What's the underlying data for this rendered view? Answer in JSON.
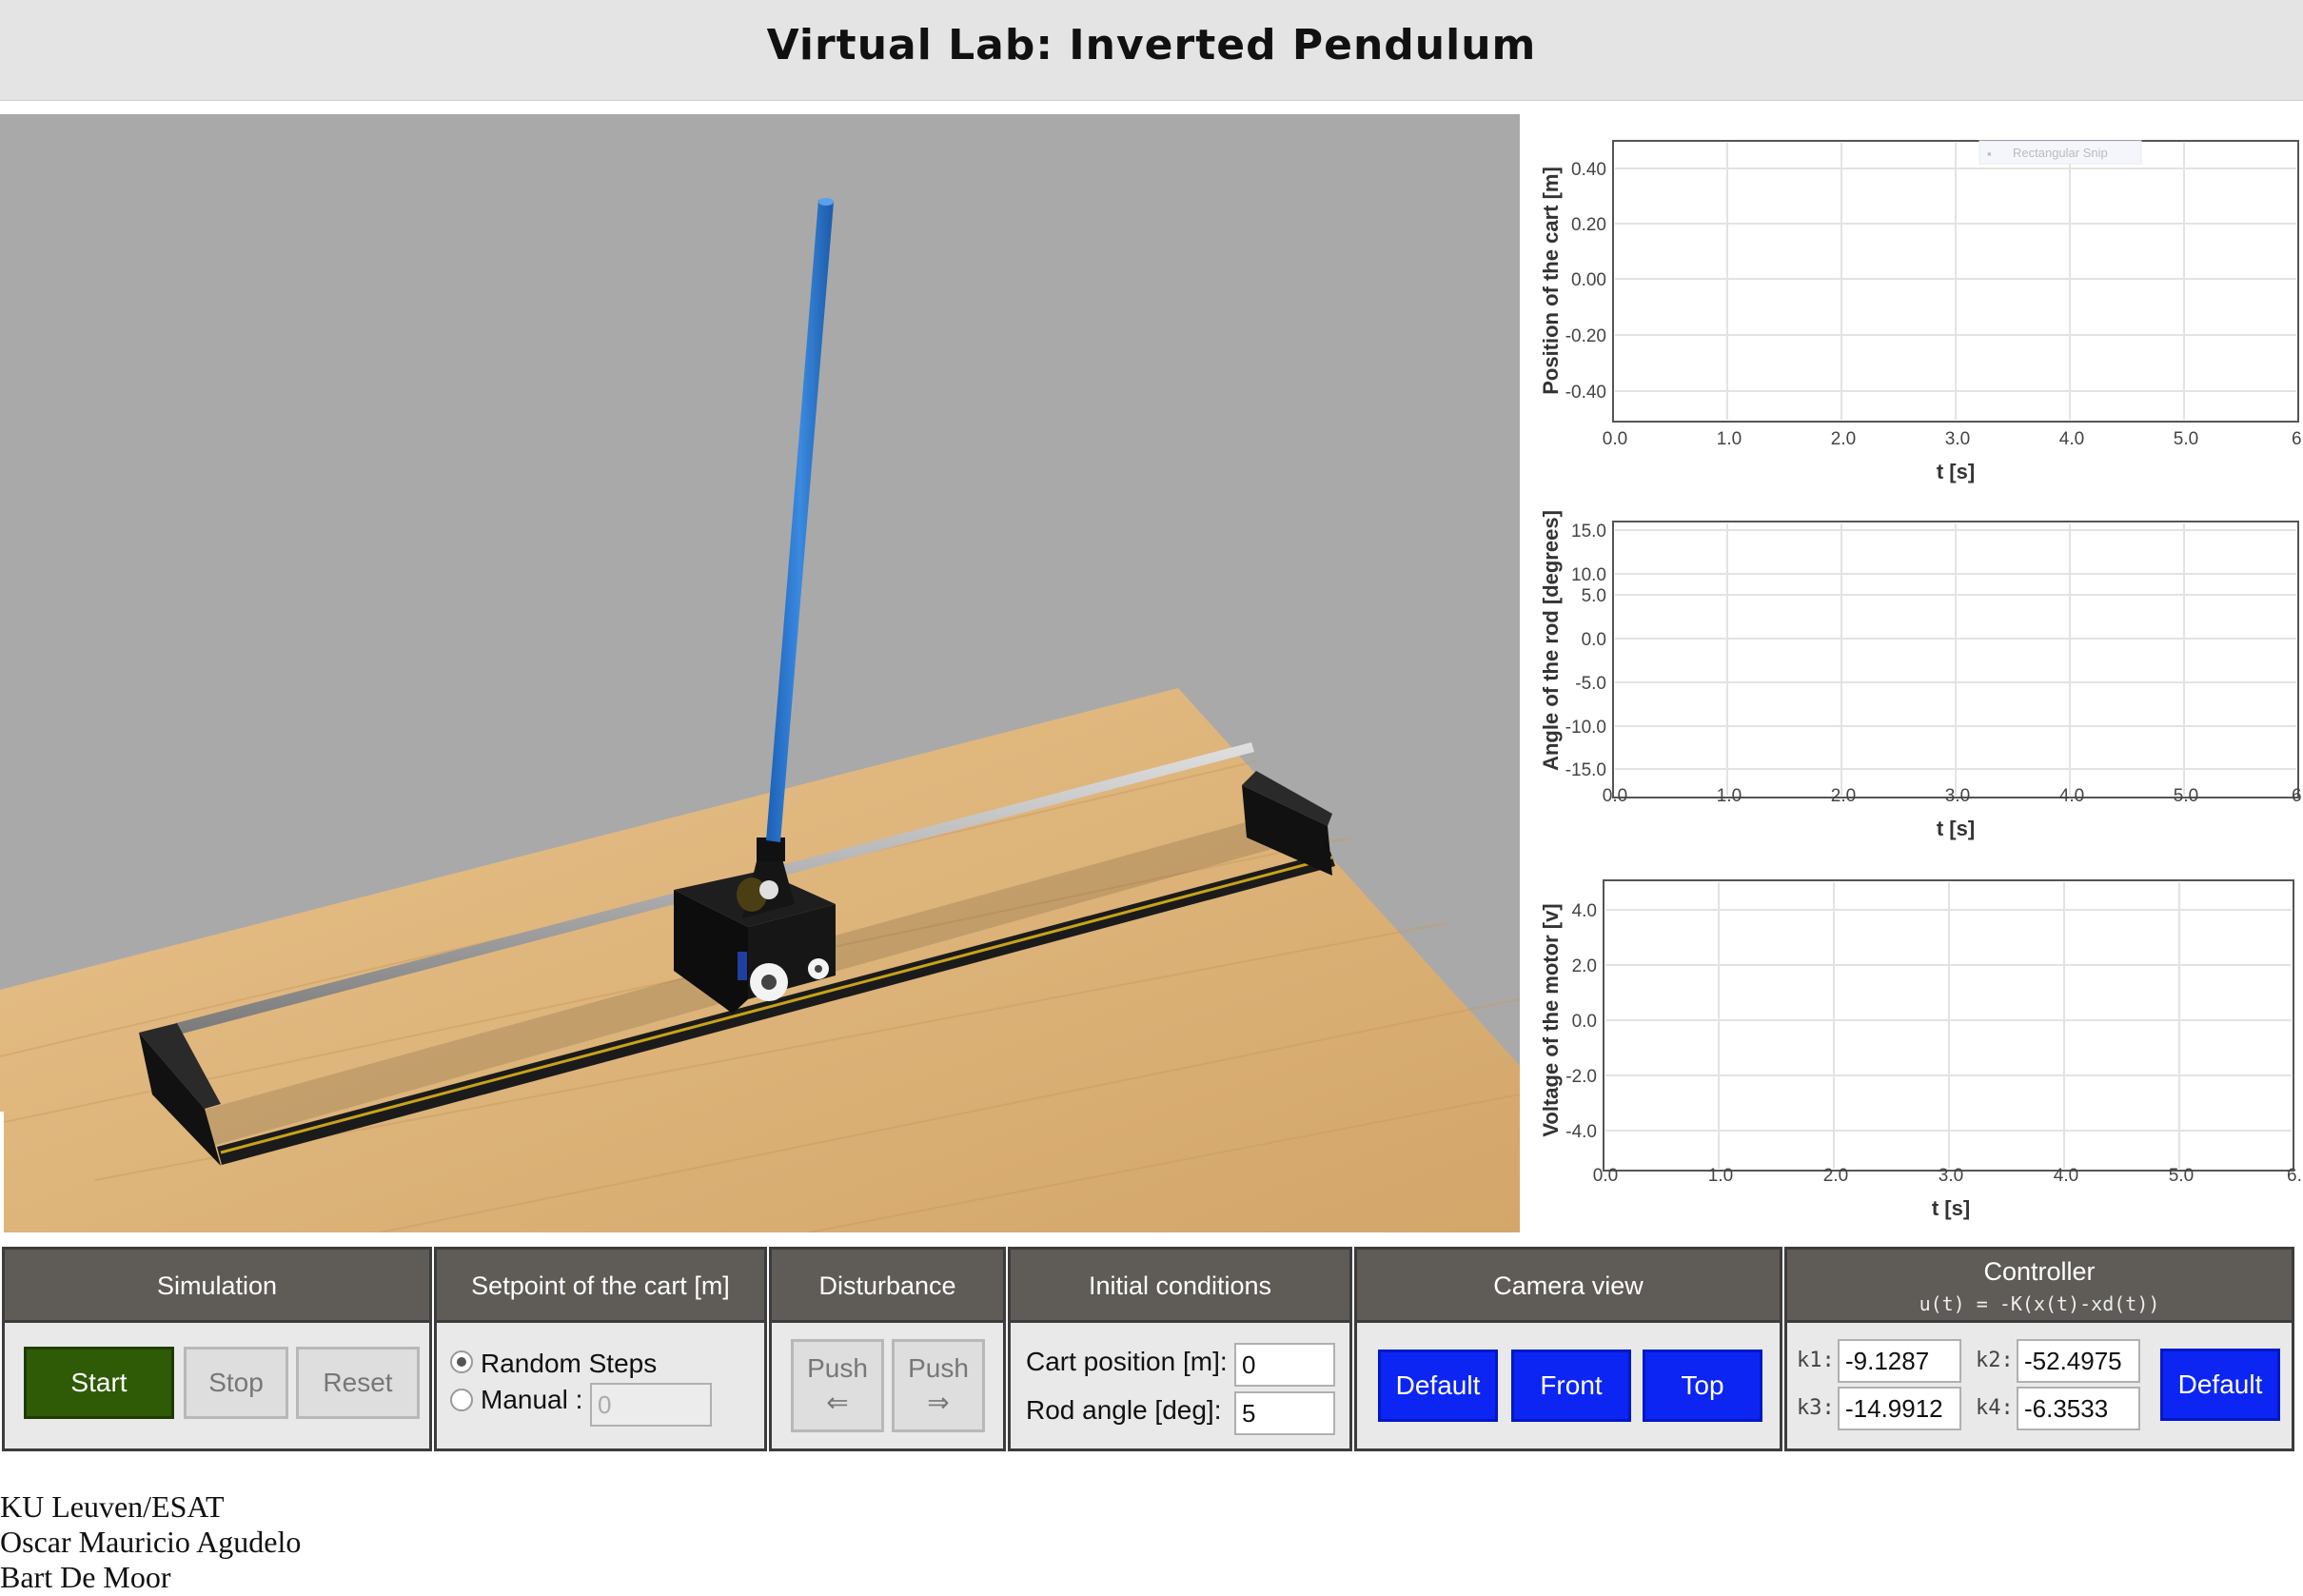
{
  "header": {
    "title": "Virtual Lab: Inverted Pendulum"
  },
  "plots": [
    {
      "ylabel": "Position of the cart [m]",
      "xlabel": "t [s]",
      "yticks": [
        "0.40",
        "0.20",
        "0.00",
        "-0.20",
        "-0.40"
      ],
      "xticks": [
        "0.0",
        "1.0",
        "2.0",
        "3.0",
        "4.0",
        "5.0",
        "6."
      ],
      "overlay": "Rectangular Snip"
    },
    {
      "ylabel": "Angle of the rod [degrees]",
      "xlabel": "t [s]",
      "yticks": [
        "15.0",
        "10.0",
        "5.0",
        "0.0",
        "-5.0",
        "-10.0",
        "-15.0"
      ],
      "xticks": [
        "0.0",
        "1.0",
        "2.0",
        "3.0",
        "4.0",
        "5.0",
        "6."
      ]
    },
    {
      "ylabel": "Voltage of the motor [v]",
      "xlabel": "t [s]",
      "yticks": [
        "4.0",
        "2.0",
        "0.0",
        "-2.0",
        "-4.0"
      ],
      "xticks": [
        "0.0",
        "1.0",
        "2.0",
        "3.0",
        "4.0",
        "5.0",
        "6."
      ]
    }
  ],
  "simulation": {
    "title": "Simulation",
    "start": "Start",
    "stop": "Stop",
    "reset": "Reset"
  },
  "setpoint": {
    "title": "Setpoint of the cart [m]",
    "random": "Random Steps",
    "manual": "Manual :",
    "manual_value": "0",
    "selected": "Random Steps"
  },
  "disturbance": {
    "title": "Disturbance",
    "push": "Push",
    "left_arrow": "⇐",
    "right_arrow": "⇒"
  },
  "initial": {
    "title": "Initial conditions",
    "cart_label": "Cart position [m]:",
    "cart_value": "0",
    "rod_label": "Rod angle [deg]:",
    "rod_value": "5"
  },
  "camera": {
    "title": "Camera view",
    "default": "Default",
    "front": "Front",
    "top": "Top"
  },
  "controller": {
    "title": "Controller",
    "formula": "u(t) = -K(x(t)-xd(t))",
    "k1_label": "k1:",
    "k1": "-9.1287",
    "k2_label": "k2:",
    "k2": "-52.4975",
    "k3_label": "k3:",
    "k3": "-14.9912",
    "k4_label": "k4:",
    "k4": "-6.3533",
    "default": "Default"
  },
  "footer": {
    "line1": "KU Leuven/ESAT",
    "line2": "Oscar Mauricio Agudelo",
    "line3": "Bart De Moor"
  },
  "colors": {
    "start": "#2f5a06",
    "camera_button": "#0c25f2",
    "rod": "#2a73cc",
    "panel_header": "#5f5b57"
  }
}
